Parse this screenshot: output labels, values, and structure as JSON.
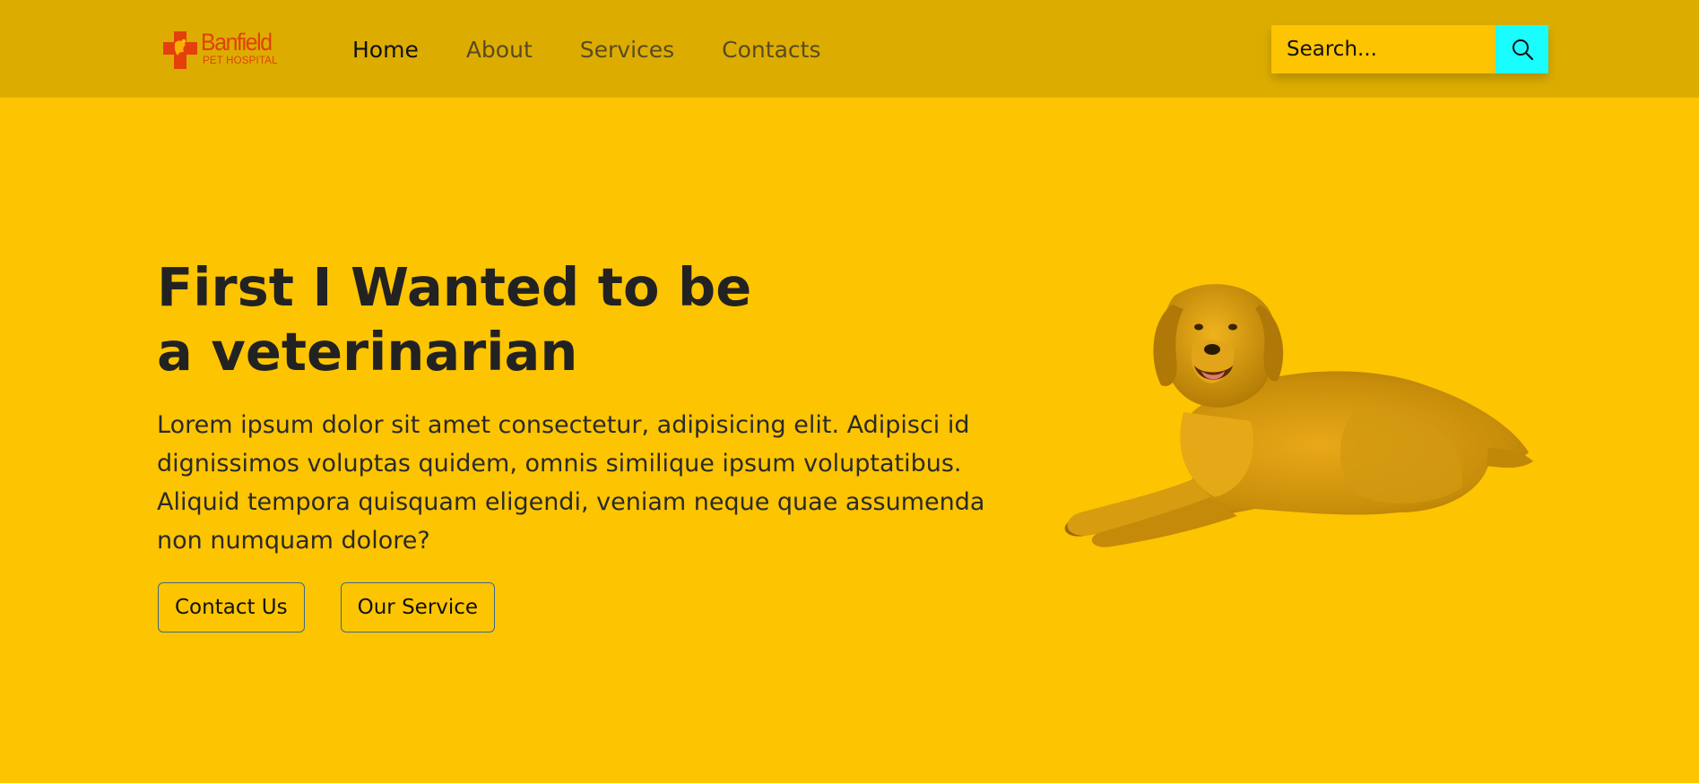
{
  "brand": {
    "name": "Banfield",
    "subtitle": "PET HOSPITAL",
    "color": "#e3400c"
  },
  "nav": {
    "items": [
      "Home",
      "About",
      "Services",
      "Contacts"
    ],
    "active": "Home"
  },
  "search": {
    "placeholder": "Search...",
    "button_icon": "search-icon",
    "button_color": "#19fdff"
  },
  "hero": {
    "title": "First I Wanted to be a veterinarian",
    "text": "Lorem ipsum dolor sit amet consectetur, adipisicing elit. Adipisci id dignissimos voluptas quidem, omnis similique ipsum voluptatibus. Aliquid tempora quisquam eligendi, veniam neque quae assumenda non numquam dolore?",
    "buttons": [
      "Contact Us",
      "Our Service"
    ],
    "image": "golden-retriever-dog"
  },
  "colors": {
    "background": "#fdc401",
    "navbar": "#dcad00",
    "text": "#222222"
  }
}
